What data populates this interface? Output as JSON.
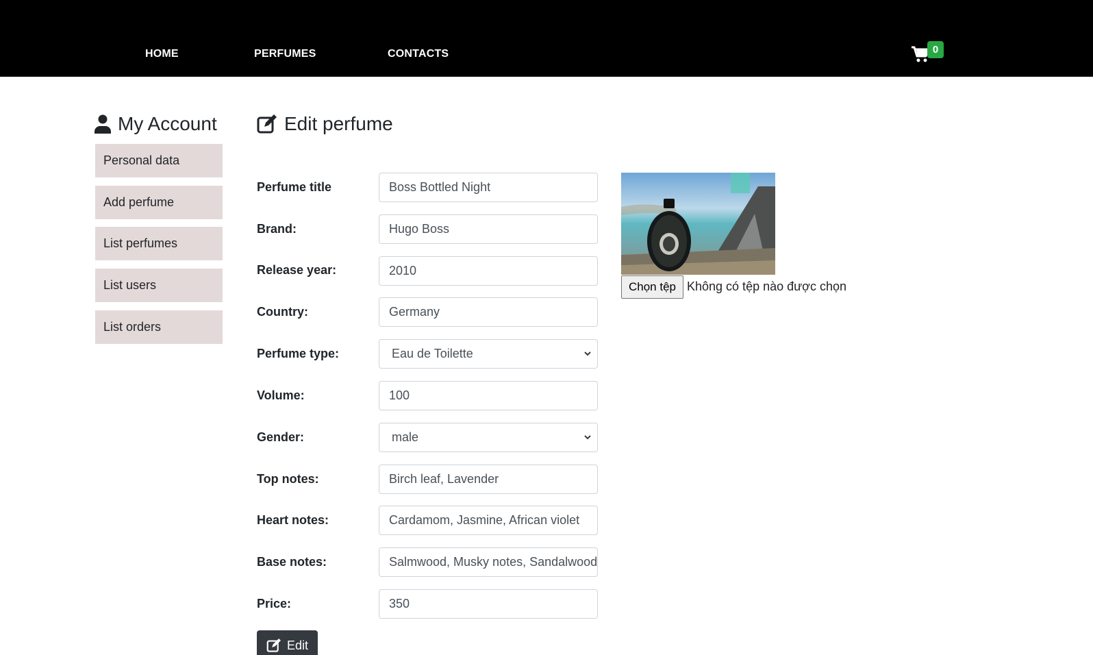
{
  "nav": {
    "home": "HOME",
    "perfumes": "PERFUMES",
    "contacts": "CONTACTS",
    "cart_count": "0"
  },
  "sidebar": {
    "title": "My Account",
    "items": [
      {
        "label": "Personal data"
      },
      {
        "label": "Add perfume"
      },
      {
        "label": "List perfumes"
      },
      {
        "label": "List users"
      },
      {
        "label": "List orders"
      }
    ]
  },
  "main": {
    "title": "Edit perfume",
    "fields": {
      "title": {
        "label": "Perfume title",
        "value": "Boss Bottled Night"
      },
      "brand": {
        "label": "Brand:",
        "value": "Hugo Boss"
      },
      "year": {
        "label": "Release year:",
        "value": "2010"
      },
      "country": {
        "label": "Country:",
        "value": "Germany"
      },
      "type": {
        "label": "Perfume type:",
        "value": "Eau de Toilette"
      },
      "volume": {
        "label": "Volume:",
        "value": "100"
      },
      "gender": {
        "label": "Gender:",
        "value": "male"
      },
      "top_notes": {
        "label": "Top notes:",
        "value": "Birch leaf, Lavender"
      },
      "heart_notes": {
        "label": "Heart notes:",
        "value": "Cardamom, Jasmine, African violet"
      },
      "base_notes": {
        "label": "Base notes:",
        "value": "Salmwood, Musky notes, Sandalwood"
      },
      "price": {
        "label": "Price:",
        "value": "350"
      }
    },
    "file": {
      "button": "Chọn tệp",
      "status": "Không có tệp nào được chọn"
    },
    "submit": "Edit"
  },
  "colors": {
    "navbar": "#000000",
    "badge": "#28a745",
    "sidebar_item": "#e4d9d9",
    "button_dark": "#343a40"
  }
}
